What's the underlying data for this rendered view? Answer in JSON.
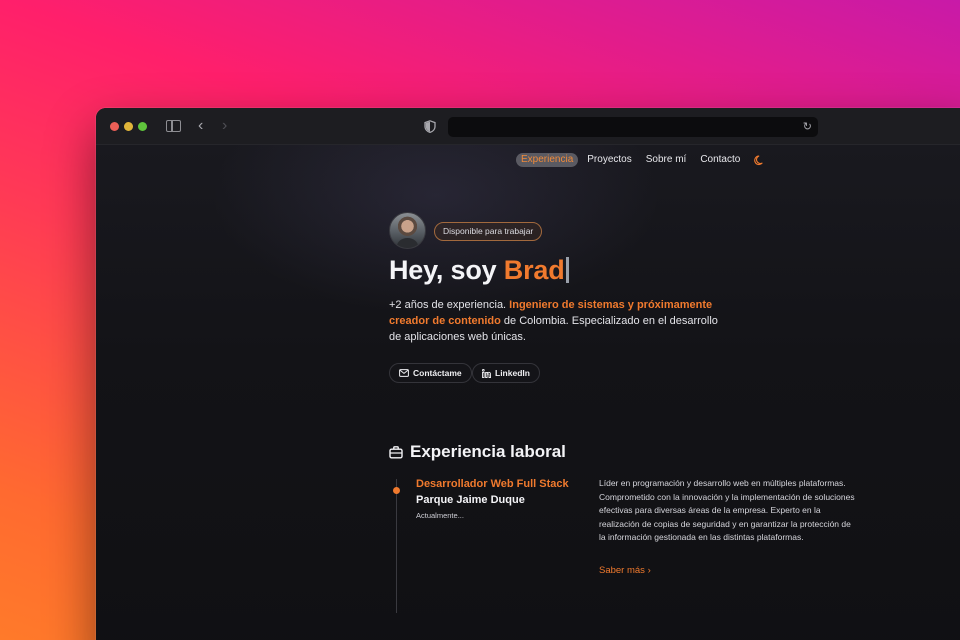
{
  "colors": {
    "accent": "#f07a2e",
    "page_bg": "#111114",
    "text": "#f4f4f7"
  },
  "browser": {
    "toolbar_icons": [
      "close-dot",
      "minimize-dot",
      "zoom-dot",
      "sidebar-icon",
      "back-icon",
      "forward-icon",
      "shield-icon",
      "reload-icon"
    ],
    "address": ""
  },
  "nav": {
    "items": [
      "Experiencia",
      "Proyectos",
      "Sobre mí",
      "Contacto"
    ],
    "active_index": 0,
    "theme_icon": "moon-icon"
  },
  "hero": {
    "badge": "Disponible para trabajar",
    "title_prefix": "Hey, soy ",
    "title_name": "Brad",
    "intro_1": "+2 años de experiencia. ",
    "intro_highlight": "Ingeniero de sistemas y próximamente creador de contenido",
    "intro_2": " de Colombia. Especializado en el desarrollo de aplicaciones web únicas.",
    "buttons": {
      "contact": "Contáctame",
      "linkedin": "LinkedIn"
    }
  },
  "experience": {
    "section_title": "Experiencia laboral",
    "section_icon": "briefcase-icon",
    "jobs": [
      {
        "title": "Desarrollador Web Full Stack",
        "company": "Parque Jaime Duque",
        "period": "Actualmente...",
        "description": "Líder en programación y desarrollo web en múltiples plataformas. Comprometido con la innovación y la implementación de soluciones efectivas para diversas áreas de la empresa. Experto en la realización de copias de seguridad y en garantizar la protección de la información gestionada en las distintas plataformas.",
        "link_label": "Saber más",
        "link_icon": "chevron-right-icon"
      }
    ]
  }
}
